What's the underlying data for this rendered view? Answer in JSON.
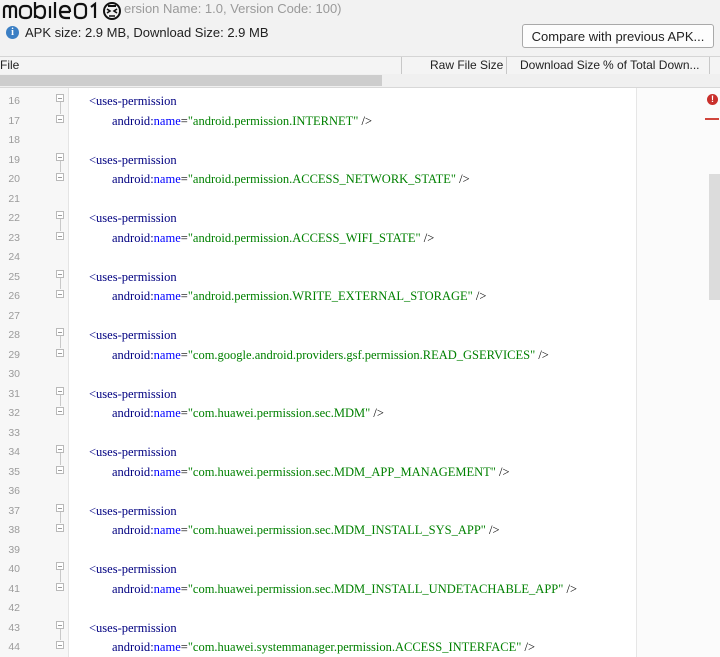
{
  "watermark": {
    "text": "mobile01"
  },
  "header": {
    "version_text": "ersion Name: 1.0, Version Code: 100)",
    "size_text": "APK size: 2.9 MB, Download Size: 2.9 MB",
    "info_icon": "info-icon",
    "compare_button": "Compare with previous APK..."
  },
  "table_header": {
    "file": "File",
    "raw_file_size": "Raw File Size",
    "download_size": "Download Size",
    "percent_total": "% of Total Down..."
  },
  "code": {
    "lines": [
      {
        "num": "16",
        "kind": "open",
        "tag": "<uses-permission"
      },
      {
        "num": "17",
        "kind": "attr",
        "ns": "android",
        "attr": "name",
        "value": "\"android.permission.INTERNET\"",
        "close": " />"
      },
      {
        "num": "18",
        "kind": "blank"
      },
      {
        "num": "19",
        "kind": "open",
        "tag": "<uses-permission"
      },
      {
        "num": "20",
        "kind": "attr",
        "ns": "android",
        "attr": "name",
        "value": "\"android.permission.ACCESS_NETWORK_STATE\"",
        "close": " />"
      },
      {
        "num": "21",
        "kind": "blank"
      },
      {
        "num": "22",
        "kind": "open",
        "tag": "<uses-permission"
      },
      {
        "num": "23",
        "kind": "attr",
        "ns": "android",
        "attr": "name",
        "value": "\"android.permission.ACCESS_WIFI_STATE\"",
        "close": " />"
      },
      {
        "num": "24",
        "kind": "blank"
      },
      {
        "num": "25",
        "kind": "open",
        "tag": "<uses-permission"
      },
      {
        "num": "26",
        "kind": "attr",
        "ns": "android",
        "attr": "name",
        "value": "\"android.permission.WRITE_EXTERNAL_STORAGE\"",
        "close": " />"
      },
      {
        "num": "27",
        "kind": "blank"
      },
      {
        "num": "28",
        "kind": "open",
        "tag": "<uses-permission"
      },
      {
        "num": "29",
        "kind": "attr",
        "ns": "android",
        "attr": "name",
        "value": "\"com.google.android.providers.gsf.permission.READ_GSERVICES\"",
        "close": " />"
      },
      {
        "num": "30",
        "kind": "blank"
      },
      {
        "num": "31",
        "kind": "open",
        "tag": "<uses-permission"
      },
      {
        "num": "32",
        "kind": "attr",
        "ns": "android",
        "attr": "name",
        "value": "\"com.huawei.permission.sec.MDM\"",
        "close": " />"
      },
      {
        "num": "33",
        "kind": "blank"
      },
      {
        "num": "34",
        "kind": "open",
        "tag": "<uses-permission"
      },
      {
        "num": "35",
        "kind": "attr",
        "ns": "android",
        "attr": "name",
        "value": "\"com.huawei.permission.sec.MDM_APP_MANAGEMENT\"",
        "close": " />"
      },
      {
        "num": "36",
        "kind": "blank"
      },
      {
        "num": "37",
        "kind": "open",
        "tag": "<uses-permission"
      },
      {
        "num": "38",
        "kind": "attr",
        "ns": "android",
        "attr": "name",
        "value": "\"com.huawei.permission.sec.MDM_INSTALL_SYS_APP\"",
        "close": " />"
      },
      {
        "num": "39",
        "kind": "blank"
      },
      {
        "num": "40",
        "kind": "open",
        "tag": "<uses-permission"
      },
      {
        "num": "41",
        "kind": "attr",
        "ns": "android",
        "attr": "name",
        "value": "\"com.huawei.permission.sec.MDM_INSTALL_UNDETACHABLE_APP\"",
        "close": " />"
      },
      {
        "num": "42",
        "kind": "blank"
      },
      {
        "num": "43",
        "kind": "open",
        "tag": "<uses-permission"
      },
      {
        "num": "44",
        "kind": "attr",
        "ns": "android",
        "attr": "name",
        "value": "\"com.huawei.systemmanager.permission.ACCESS_INTERFACE\"",
        "close": " />"
      }
    ]
  },
  "icons": {
    "error": "error-icon",
    "fold": "fold-icon"
  },
  "colors": {
    "tag": "#000080",
    "attr": "#0000ff",
    "value": "#008000",
    "error": "#c9302c"
  }
}
